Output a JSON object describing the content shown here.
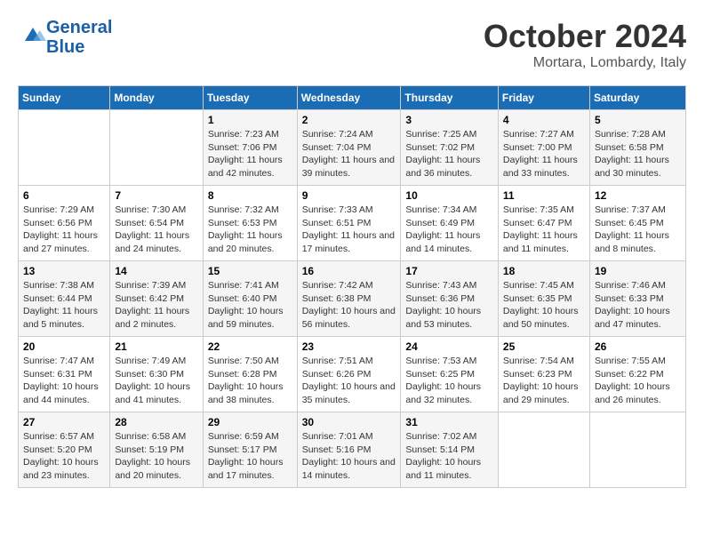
{
  "header": {
    "logo_line1": "General",
    "logo_line2": "Blue",
    "month": "October 2024",
    "location": "Mortara, Lombardy, Italy"
  },
  "weekdays": [
    "Sunday",
    "Monday",
    "Tuesday",
    "Wednesday",
    "Thursday",
    "Friday",
    "Saturday"
  ],
  "weeks": [
    [
      {
        "day": "",
        "info": ""
      },
      {
        "day": "",
        "info": ""
      },
      {
        "day": "1",
        "info": "Sunrise: 7:23 AM\nSunset: 7:06 PM\nDaylight: 11 hours and 42 minutes."
      },
      {
        "day": "2",
        "info": "Sunrise: 7:24 AM\nSunset: 7:04 PM\nDaylight: 11 hours and 39 minutes."
      },
      {
        "day": "3",
        "info": "Sunrise: 7:25 AM\nSunset: 7:02 PM\nDaylight: 11 hours and 36 minutes."
      },
      {
        "day": "4",
        "info": "Sunrise: 7:27 AM\nSunset: 7:00 PM\nDaylight: 11 hours and 33 minutes."
      },
      {
        "day": "5",
        "info": "Sunrise: 7:28 AM\nSunset: 6:58 PM\nDaylight: 11 hours and 30 minutes."
      }
    ],
    [
      {
        "day": "6",
        "info": "Sunrise: 7:29 AM\nSunset: 6:56 PM\nDaylight: 11 hours and 27 minutes."
      },
      {
        "day": "7",
        "info": "Sunrise: 7:30 AM\nSunset: 6:54 PM\nDaylight: 11 hours and 24 minutes."
      },
      {
        "day": "8",
        "info": "Sunrise: 7:32 AM\nSunset: 6:53 PM\nDaylight: 11 hours and 20 minutes."
      },
      {
        "day": "9",
        "info": "Sunrise: 7:33 AM\nSunset: 6:51 PM\nDaylight: 11 hours and 17 minutes."
      },
      {
        "day": "10",
        "info": "Sunrise: 7:34 AM\nSunset: 6:49 PM\nDaylight: 11 hours and 14 minutes."
      },
      {
        "day": "11",
        "info": "Sunrise: 7:35 AM\nSunset: 6:47 PM\nDaylight: 11 hours and 11 minutes."
      },
      {
        "day": "12",
        "info": "Sunrise: 7:37 AM\nSunset: 6:45 PM\nDaylight: 11 hours and 8 minutes."
      }
    ],
    [
      {
        "day": "13",
        "info": "Sunrise: 7:38 AM\nSunset: 6:44 PM\nDaylight: 11 hours and 5 minutes."
      },
      {
        "day": "14",
        "info": "Sunrise: 7:39 AM\nSunset: 6:42 PM\nDaylight: 11 hours and 2 minutes."
      },
      {
        "day": "15",
        "info": "Sunrise: 7:41 AM\nSunset: 6:40 PM\nDaylight: 10 hours and 59 minutes."
      },
      {
        "day": "16",
        "info": "Sunrise: 7:42 AM\nSunset: 6:38 PM\nDaylight: 10 hours and 56 minutes."
      },
      {
        "day": "17",
        "info": "Sunrise: 7:43 AM\nSunset: 6:36 PM\nDaylight: 10 hours and 53 minutes."
      },
      {
        "day": "18",
        "info": "Sunrise: 7:45 AM\nSunset: 6:35 PM\nDaylight: 10 hours and 50 minutes."
      },
      {
        "day": "19",
        "info": "Sunrise: 7:46 AM\nSunset: 6:33 PM\nDaylight: 10 hours and 47 minutes."
      }
    ],
    [
      {
        "day": "20",
        "info": "Sunrise: 7:47 AM\nSunset: 6:31 PM\nDaylight: 10 hours and 44 minutes."
      },
      {
        "day": "21",
        "info": "Sunrise: 7:49 AM\nSunset: 6:30 PM\nDaylight: 10 hours and 41 minutes."
      },
      {
        "day": "22",
        "info": "Sunrise: 7:50 AM\nSunset: 6:28 PM\nDaylight: 10 hours and 38 minutes."
      },
      {
        "day": "23",
        "info": "Sunrise: 7:51 AM\nSunset: 6:26 PM\nDaylight: 10 hours and 35 minutes."
      },
      {
        "day": "24",
        "info": "Sunrise: 7:53 AM\nSunset: 6:25 PM\nDaylight: 10 hours and 32 minutes."
      },
      {
        "day": "25",
        "info": "Sunrise: 7:54 AM\nSunset: 6:23 PM\nDaylight: 10 hours and 29 minutes."
      },
      {
        "day": "26",
        "info": "Sunrise: 7:55 AM\nSunset: 6:22 PM\nDaylight: 10 hours and 26 minutes."
      }
    ],
    [
      {
        "day": "27",
        "info": "Sunrise: 6:57 AM\nSunset: 5:20 PM\nDaylight: 10 hours and 23 minutes."
      },
      {
        "day": "28",
        "info": "Sunrise: 6:58 AM\nSunset: 5:19 PM\nDaylight: 10 hours and 20 minutes."
      },
      {
        "day": "29",
        "info": "Sunrise: 6:59 AM\nSunset: 5:17 PM\nDaylight: 10 hours and 17 minutes."
      },
      {
        "day": "30",
        "info": "Sunrise: 7:01 AM\nSunset: 5:16 PM\nDaylight: 10 hours and 14 minutes."
      },
      {
        "day": "31",
        "info": "Sunrise: 7:02 AM\nSunset: 5:14 PM\nDaylight: 10 hours and 11 minutes."
      },
      {
        "day": "",
        "info": ""
      },
      {
        "day": "",
        "info": ""
      }
    ]
  ]
}
